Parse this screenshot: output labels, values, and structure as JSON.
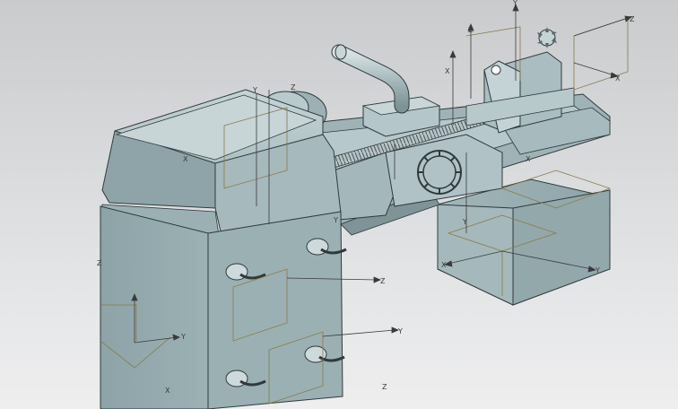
{
  "viewport": {
    "background_top": "#c9cbcd",
    "background_bottom": "#eeeeef"
  },
  "model": {
    "body_color": "#9fb3b7",
    "body_shade": "#7f9598",
    "body_light": "#b9cbce",
    "edge_color": "#2f3a3c",
    "csys_color": "#8a7a4a"
  },
  "axis_labels": {
    "x": "X",
    "y": "Y",
    "z": "Z"
  }
}
